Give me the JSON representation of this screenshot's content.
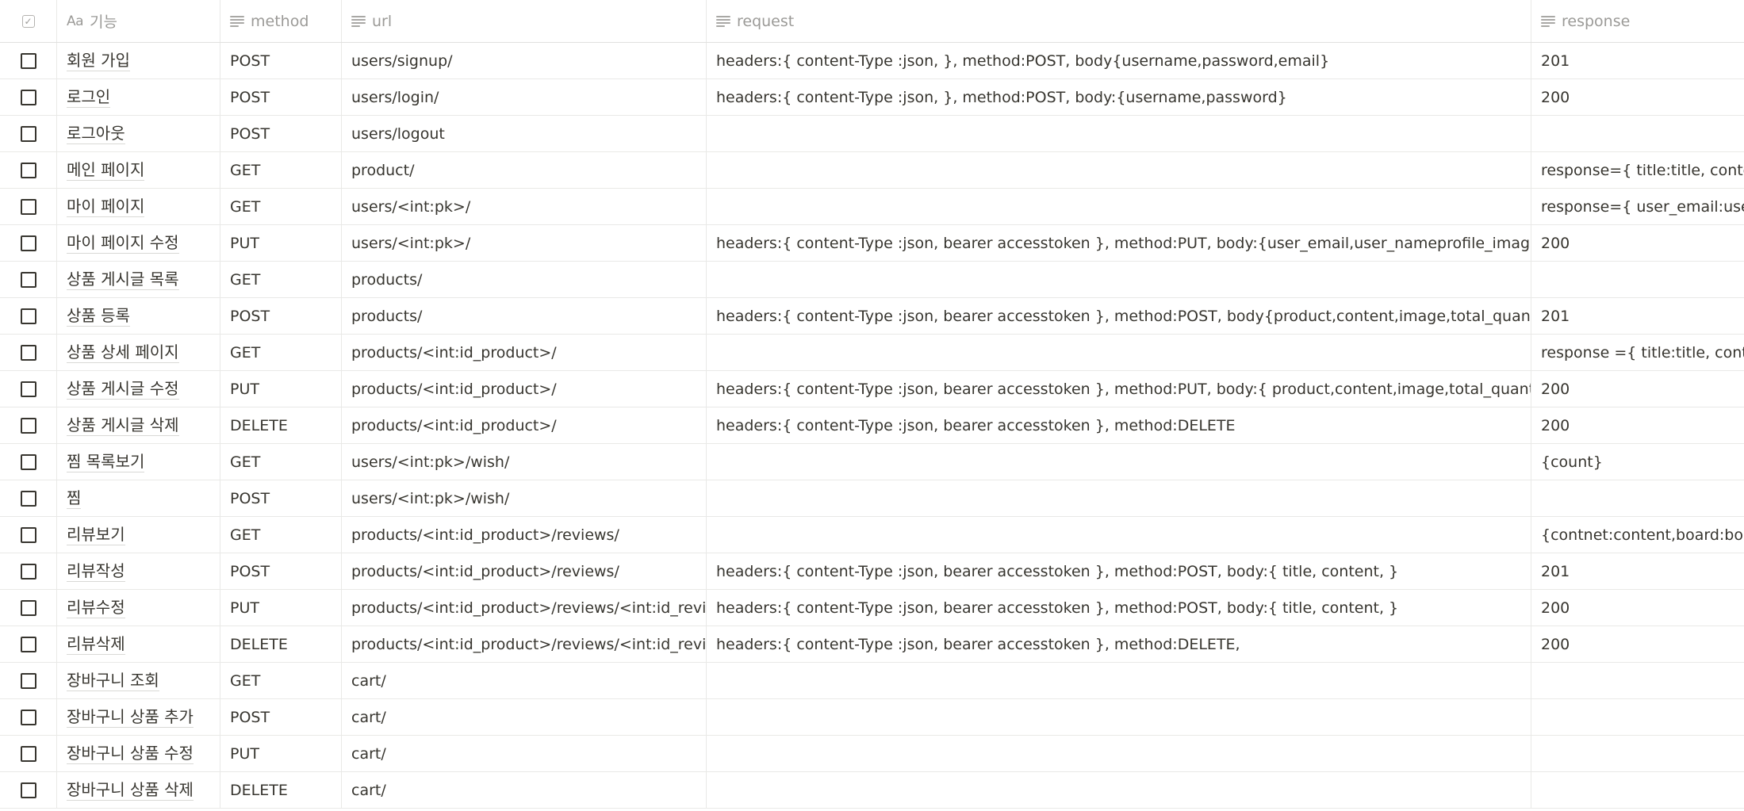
{
  "columns": {
    "check_icon": "checkbox-icon",
    "name_icon": "Aa",
    "name": "기능",
    "method": "method",
    "url": "url",
    "request": "request",
    "response": "response"
  },
  "rows": [
    {
      "name": "회원 가입",
      "method": "POST",
      "url": "users/signup/",
      "request": "headers:{ content-Type :json, }, method:POST, body{username,password,email}",
      "response": "201"
    },
    {
      "name": "로그인",
      "method": "POST",
      "url": "users/login/",
      "request": "headers:{ content-Type :json, }, method:POST, body:{username,password}",
      "response": "200"
    },
    {
      "name": "로그아웃",
      "method": "POST",
      "url": "users/logout",
      "request": "",
      "response": ""
    },
    {
      "name": "메인 페이지",
      "method": "GET",
      "url": "product/",
      "request": "",
      "response": "response={ title:title, content"
    },
    {
      "name": "마이 페이지",
      "method": "GET",
      "url": "users/<int:pk>/",
      "request": "",
      "response": "response={ user_email:user_e"
    },
    {
      "name": "마이 페이지 수정",
      "method": "PUT",
      "url": "users/<int:pk>/",
      "request": "headers:{ content-Type :json, bearer accesstoken }, method:PUT, body:{user_email,user_nameprofile_image,nickname,}",
      "response": "200"
    },
    {
      "name": "상품 게시글 목록",
      "method": "GET",
      "url": "products/",
      "request": "",
      "response": ""
    },
    {
      "name": "상품 등록",
      "method": "POST",
      "url": "products/",
      "request": "headers:{ content-Type :json, bearer accesstoken }, method:POST, body{product,content,image,total_quantity, price}",
      "response": "201"
    },
    {
      "name": "상품 상세 페이지",
      "method": "GET",
      "url": "products/<int:id_product>/",
      "request": "",
      "response": "response ={ title:title, conten"
    },
    {
      "name": "상품 게시글 수정",
      "method": "PUT",
      "url": "products/<int:id_product>/",
      "request": "headers:{ content-Type :json, bearer accesstoken }, method:PUT, body:{ product,content,image,total_quantity, price}",
      "response": "200"
    },
    {
      "name": "상품 게시글 삭제",
      "method": "DELETE",
      "url": "products/<int:id_product>/",
      "request": "headers:{ content-Type :json, bearer accesstoken }, method:DELETE",
      "response": "200"
    },
    {
      "name": "찜 목록보기",
      "method": "GET",
      "url": "users/<int:pk>/wish/",
      "request": "",
      "response": "{count}"
    },
    {
      "name": "찜",
      "method": "POST",
      "url": "users/<int:pk>/wish/",
      "request": "",
      "response": ""
    },
    {
      "name": "리뷰보기",
      "method": "GET",
      "url": "products/<int:id_product>/reviews/",
      "request": "",
      "response": "{contnet:content,board:board"
    },
    {
      "name": "리뷰작성",
      "method": "POST",
      "url": "products/<int:id_product>/reviews/",
      "request": "headers:{ content-Type :json, bearer accesstoken }, method:POST, body:{ title, content, }",
      "response": "201"
    },
    {
      "name": "리뷰수정",
      "method": "PUT",
      "url": "products/<int:id_product>/reviews/<int:id_review>",
      "request": "headers:{ content-Type :json, bearer accesstoken }, method:POST, body:{ title, content, }",
      "response": "200"
    },
    {
      "name": "리뷰삭제",
      "method": "DELETE",
      "url": "products/<int:id_product>/reviews/<int:id_review>",
      "request": "headers:{ content-Type :json, bearer accesstoken }, method:DELETE,",
      "response": "200"
    },
    {
      "name": "장바구니 조회",
      "method": "GET",
      "url": "cart/",
      "request": "",
      "response": ""
    },
    {
      "name": "장바구니 상품 추가",
      "method": "POST",
      "url": "cart/",
      "request": "",
      "response": ""
    },
    {
      "name": "장바구니 상품 수정",
      "method": "PUT",
      "url": "cart/",
      "request": "",
      "response": ""
    },
    {
      "name": "장바구니 상품 삭제",
      "method": "DELETE",
      "url": "cart/",
      "request": "",
      "response": ""
    }
  ]
}
